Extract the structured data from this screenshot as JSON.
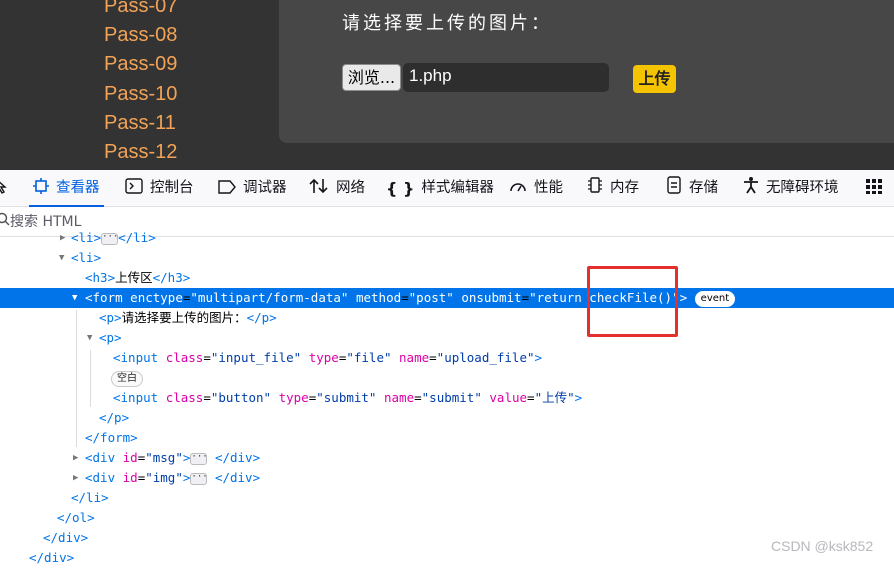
{
  "page": {
    "pass_list": [
      "Pass-07",
      "Pass-08",
      "Pass-09",
      "Pass-10",
      "Pass-11",
      "Pass-12"
    ],
    "upload_prompt": "请选择要上传的图片：",
    "browse_label": "浏览...",
    "file_name": "1.php",
    "upload_label": "上传"
  },
  "toolbar": {
    "tabs": [
      {
        "label": "查看器",
        "icon": "inspector-icon"
      },
      {
        "label": "控制台",
        "icon": "console-icon"
      },
      {
        "label": "调试器",
        "icon": "debugger-icon"
      },
      {
        "label": "网络",
        "icon": "network-icon"
      },
      {
        "label": "样式编辑器",
        "icon": "style-editor-icon"
      },
      {
        "label": "性能",
        "icon": "performance-icon"
      },
      {
        "label": "内存",
        "icon": "memory-icon"
      },
      {
        "label": "存储",
        "icon": "storage-icon"
      },
      {
        "label": "无障碍环境",
        "icon": "accessibility-icon"
      }
    ],
    "active_tab": "查看器"
  },
  "search": {
    "placeholder": "搜索 HTML"
  },
  "tree": {
    "r0": {
      "t1": "<li>",
      "t2": "</li>"
    },
    "r1": {
      "t1": "<li>"
    },
    "r2": {
      "t1": "<h3>",
      "text": "上传区",
      "t2": "</h3>"
    },
    "r3": {
      "t1": "<form",
      "a1": "enctype",
      "v1": "\"multipart/form-data\"",
      "a2": "method",
      "v2": "\"post\"",
      "a3": "onsubmit",
      "v3": "\"return checkFile()\"",
      "t2": ">",
      "badge": "event"
    },
    "r4": {
      "t1": "<p>",
      "text": "请选择要上传的图片：",
      "t2": "</p>"
    },
    "r5": {
      "t1": "<p>"
    },
    "r6": {
      "t1": "<input",
      "a1": "class",
      "v1": "\"input_file\"",
      "a2": "type",
      "v2": "\"file\"",
      "a3": "name",
      "v3": "\"upload_file\"",
      "t2": ">"
    },
    "r7": {
      "badge": "空白"
    },
    "r8": {
      "t1": "<input",
      "a1": "class",
      "v1": "\"button\"",
      "a2": "type",
      "v2": "\"submit\"",
      "a3": "name",
      "v3": "\"submit\"",
      "a4": "value",
      "v4": "\"上传\"",
      "t2": ">"
    },
    "r9": {
      "t1": "</p>"
    },
    "r10": {
      "t1": "</form>"
    },
    "r11": {
      "t1": "<div",
      "a1": "id",
      "v1": "\"msg\"",
      "t2": ">",
      "t3": "</div>"
    },
    "r12": {
      "t1": "<div",
      "a1": "id",
      "v1": "\"img\"",
      "t2": ">",
      "t3": "</div>"
    },
    "r13": {
      "t1": "</li>"
    },
    "r14": {
      "t1": "</ol>"
    },
    "r15": {
      "t1": "</div>"
    },
    "r16": {
      "t1": "</div>"
    }
  },
  "watermark": "CSDN @ksk852",
  "colors": {
    "accent": "#0074e8",
    "highlight_box": "#e3302f",
    "upload_button": "#f5c400",
    "pass_link": "#f2a356"
  }
}
